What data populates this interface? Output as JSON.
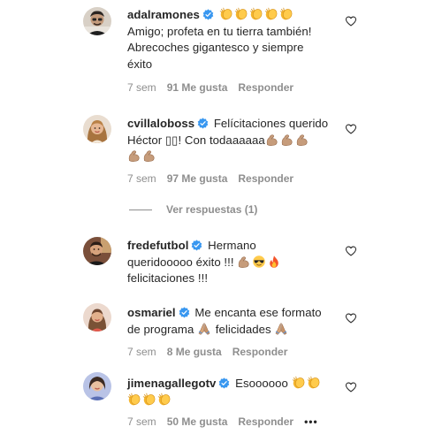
{
  "comments": [
    {
      "username": "adalramones",
      "text_lines": [
        "Amigo; profeta en tu tierra también!",
        "Abrecoches gigantesco y siempre",
        "éxito"
      ],
      "time": "7 sem",
      "likes": "91 Me gusta",
      "reply": "Responder",
      "avatar_icon": "person-avatar-icon"
    },
    {
      "username": "cvillaloboss",
      "line1": "Felícitaciones querido",
      "line2": "Héctor ▯▯! Con todaaaaaa",
      "time": "7 sem",
      "likes": "97 Me gusta",
      "reply": "Responder",
      "avatar_icon": "person-avatar-icon"
    },
    {
      "username": "fredefutbol",
      "line1": "Hermano",
      "line2": "queridooooo éxito !!!",
      "line3": "felicitaciones !!!",
      "avatar_icon": "person-avatar-icon"
    },
    {
      "username": "osmariel",
      "line1": "Me encanta ese formato",
      "line2": "de programa",
      "line2b": "felicidades",
      "time": "7 sem",
      "likes": "8 Me gusta",
      "reply": "Responder",
      "avatar_icon": "person-avatar-icon"
    },
    {
      "username": "jimenagallegotv",
      "line1": "Esoooooo",
      "time": "7 sem",
      "likes": "50 Me gusta",
      "reply": "Responder",
      "more": "•••",
      "avatar_icon": "person-avatar-icon"
    }
  ],
  "view_replies": "Ver respuestas (1)",
  "icons": {
    "verified": "verified-badge-icon",
    "heart": "heart-outline-icon",
    "clap": "clapping-hands-emoji",
    "muscle": "flexed-biceps-emoji",
    "sunglasses": "sunglasses-emoji",
    "fire": "fire-emoji",
    "pray": "folded-hands-emoji"
  },
  "colors": {
    "text": "#262626",
    "meta": "#8e8e8e",
    "verified": "#3897f0"
  }
}
